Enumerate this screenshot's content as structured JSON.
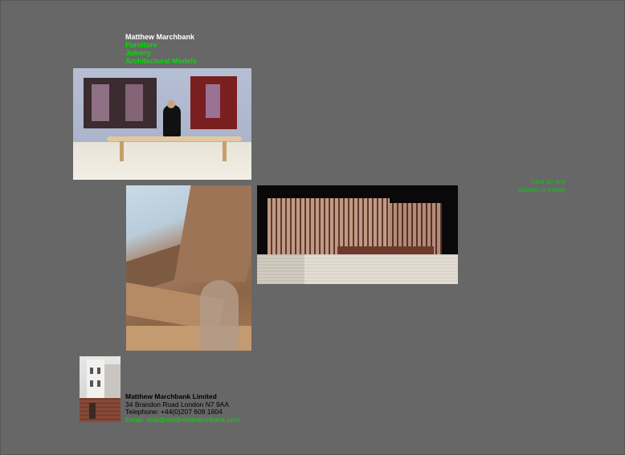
{
  "nav": {
    "name": "Matthew Marchbank",
    "links": [
      "Furniture",
      "Joinery",
      "Architectural Models"
    ]
  },
  "hint": {
    "line1": "Click on any",
    "line2": "subject or image"
  },
  "contact": {
    "company": "Matthew Marchbank Limited",
    "address": "34 Brandon Road London N7 9AA",
    "telephone": "Telephone: +44(0)207 609 1604",
    "email": "Email: mail@matthewmarchbank.com"
  },
  "colors": {
    "background": "#676767",
    "link": "#00e000",
    "heading": "#ffffff",
    "text": "#000000"
  }
}
